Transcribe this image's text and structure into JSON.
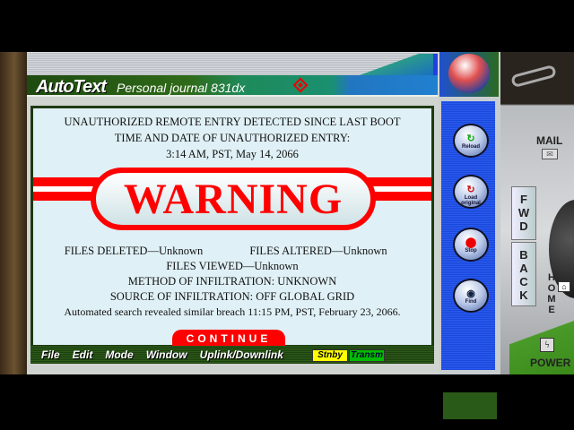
{
  "header": {
    "logo": "AutoText",
    "subtitle": "Personal journal 831dx"
  },
  "screen": {
    "line1": "UNAUTHORIZED REMOTE ENTRY DETECTED SINCE LAST BOOT",
    "line2": "TIME AND DATE OF UNAUTHORIZED ENTRY:",
    "line3": "3:14 AM, PST,  May 14, 2066",
    "warning": "WARNING",
    "files_deleted": "FILES DELETED—Unknown",
    "files_altered": "FILES ALTERED—Unknown",
    "files_viewed": "FILES VIEWED—Unknown",
    "method": "METHOD OF INFILTRATION: UNKNOWN",
    "source": "SOURCE OF INFILTRATION: OFF GLOBAL GRID",
    "search": "Automated search revealed similar breach  11:15 PM, PST, February 23, 2066.",
    "continue": "CONTINUE"
  },
  "menu": [
    "File",
    "Edit",
    "Mode",
    "Window",
    "Uplink/Downlink"
  ],
  "status": {
    "stnby": "Stnby",
    "transm": "Transm"
  },
  "side_buttons": [
    {
      "label": "Reload",
      "icon": "reload-icon"
    },
    {
      "label": "Load original",
      "icon": "load-original-icon"
    },
    {
      "label": "Stop",
      "icon": "stop-icon"
    },
    {
      "label": "Find",
      "icon": "eye-icon"
    }
  ],
  "nav": {
    "mail": "MAIL",
    "fwd": "FWD",
    "back": "BACK",
    "home": "HOME",
    "power": "POWER"
  },
  "colors": {
    "warning": "#ff0000",
    "panel_blue": "#2a5af0",
    "title_green": "#2f6a18"
  }
}
